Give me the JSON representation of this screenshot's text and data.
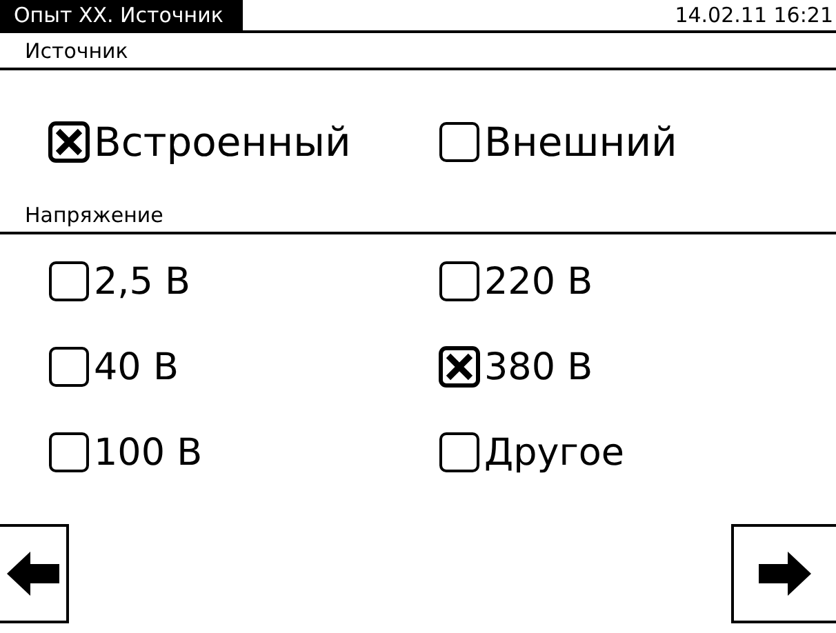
{
  "header": {
    "title": "Опыт XX. Источник",
    "datetime": "14.02.11 16:21"
  },
  "sections": [
    {
      "label": "Источник",
      "options": [
        {
          "label": "Встроенный",
          "checked": true
        },
        {
          "label": "Внешний",
          "checked": false
        }
      ]
    },
    {
      "label": "Напряжение",
      "options": [
        {
          "label": "2,5 В",
          "checked": false
        },
        {
          "label": "220 В",
          "checked": false
        },
        {
          "label": "40 В",
          "checked": false
        },
        {
          "label": "380 В",
          "checked": true
        },
        {
          "label": "100 В",
          "checked": false
        },
        {
          "label": "Другое",
          "checked": false
        }
      ]
    }
  ]
}
